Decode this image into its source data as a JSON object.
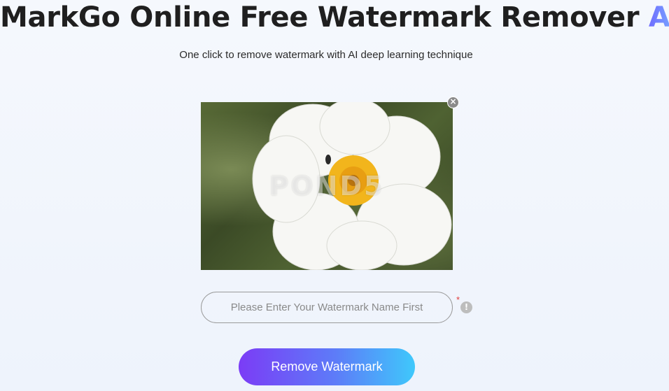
{
  "header": {
    "title_main": "MarkGo Online Free Watermark Remover ",
    "title_accent": "AI",
    "subtitle": "One click to remove watermark with AI deep learning technique"
  },
  "preview": {
    "watermark_text": "POND5",
    "close_symbol": "×"
  },
  "form": {
    "input_placeholder": "Please Enter Your Watermark Name First",
    "input_value": "",
    "required_marker": "*",
    "info_symbol": "!"
  },
  "actions": {
    "remove_label": "Remove Watermark"
  },
  "colors": {
    "title": "#1f1f1f",
    "accent_start": "#6f6cff",
    "accent_end": "#7ab8ff",
    "button_start": "#7b3cf6",
    "button_end": "#3fc8fb",
    "required": "#e23b3b"
  }
}
